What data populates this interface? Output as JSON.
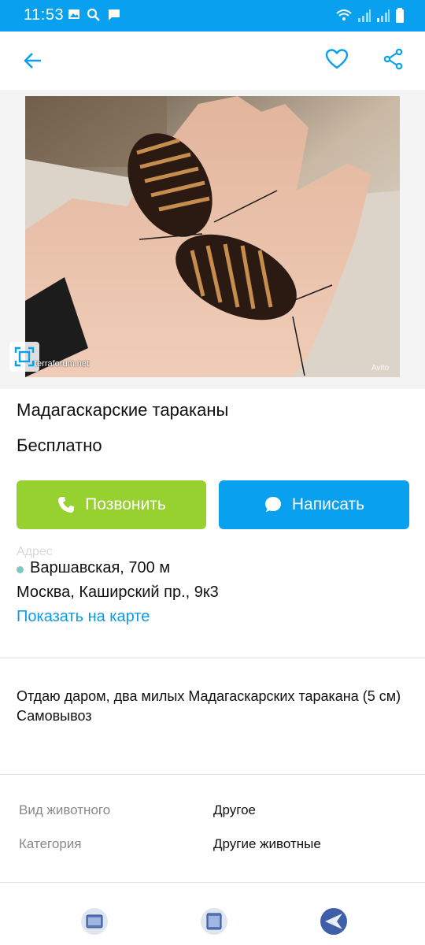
{
  "status_bar": {
    "time": "11:53",
    "left_icons": [
      "image-icon",
      "search-icon",
      "message-icon"
    ],
    "right_icons": [
      "wifi-icon",
      "signal-icon",
      "signal-icon",
      "battery-icon"
    ],
    "color": "#0aa0f0"
  },
  "app_bar": {
    "back_icon": "arrow-left-icon",
    "favorite_icon": "heart-outline-icon",
    "share_icon": "share-icon",
    "accent": "#0aa0f0"
  },
  "photo": {
    "watermark": "terraforum.net",
    "logo": "Avito",
    "fullscreen_icon": "fullscreen-icon"
  },
  "listing": {
    "title": "Мадагаскарские тараканы",
    "price": "Бесплатно"
  },
  "actions": {
    "call_label": "Позвонить",
    "write_label": "Написать",
    "call_color": "#97d130",
    "write_color": "#0aa0f0"
  },
  "location": {
    "faded_label": "Адрес",
    "metro": "Варшавская, 700 м",
    "address": "Москва, Каширский пр., 9к3",
    "map_link": "Показать на карте"
  },
  "description": {
    "line1": "Отдаю даром, два милых Мадагаскарских таракана (5 см)",
    "line2": "Самовывоз"
  },
  "params": [
    {
      "label": "Вид животного",
      "value": "Другое"
    },
    {
      "label": "Категория",
      "value": "Другие животные"
    }
  ]
}
